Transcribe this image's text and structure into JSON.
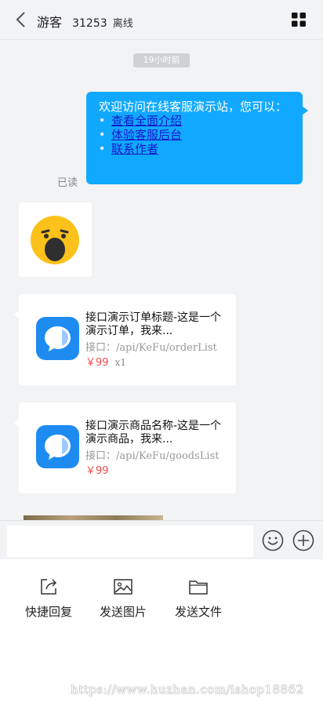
{
  "header": {
    "back_icon": "chevron-left-icon",
    "name": "游客",
    "uid": "31253",
    "status": "离线",
    "menu_icon": "grid-icon"
  },
  "messages": {
    "time": "19小时前",
    "welcome": {
      "line": "欢迎访问在线客服演示站，您可以：",
      "links": [
        "查看全面介绍",
        "体验客服后台",
        "联系作者"
      ],
      "read_status": "已读"
    },
    "emoji_icon": "yawning-face-icon",
    "order_card": {
      "title": "接口演示订单标题-这是一个演示订单，我来...",
      "api": "接口：/api/KeFu/orderList",
      "price": "￥99",
      "qty": "x1"
    },
    "goods_card": {
      "title": "接口演示商品名称-这是一个演示商品，我来...",
      "api": "接口：/api/KeFu/goodsList",
      "price": "￥99"
    }
  },
  "input": {
    "value": "",
    "emoji_icon": "smiley-icon",
    "plus_icon": "plus-circle-icon"
  },
  "tools": [
    {
      "label": "快捷回复",
      "icon": "share-icon"
    },
    {
      "label": "发送图片",
      "icon": "image-icon"
    },
    {
      "label": "发送文件",
      "icon": "folder-icon"
    }
  ],
  "watermark": "https://www.huzhan.com/ishop18862",
  "colors": {
    "bubble_blue": "#11a9ff",
    "link": "#1a16c9",
    "price_red": "#f04b4b",
    "app_icon_blue": "#1e8bf1"
  }
}
